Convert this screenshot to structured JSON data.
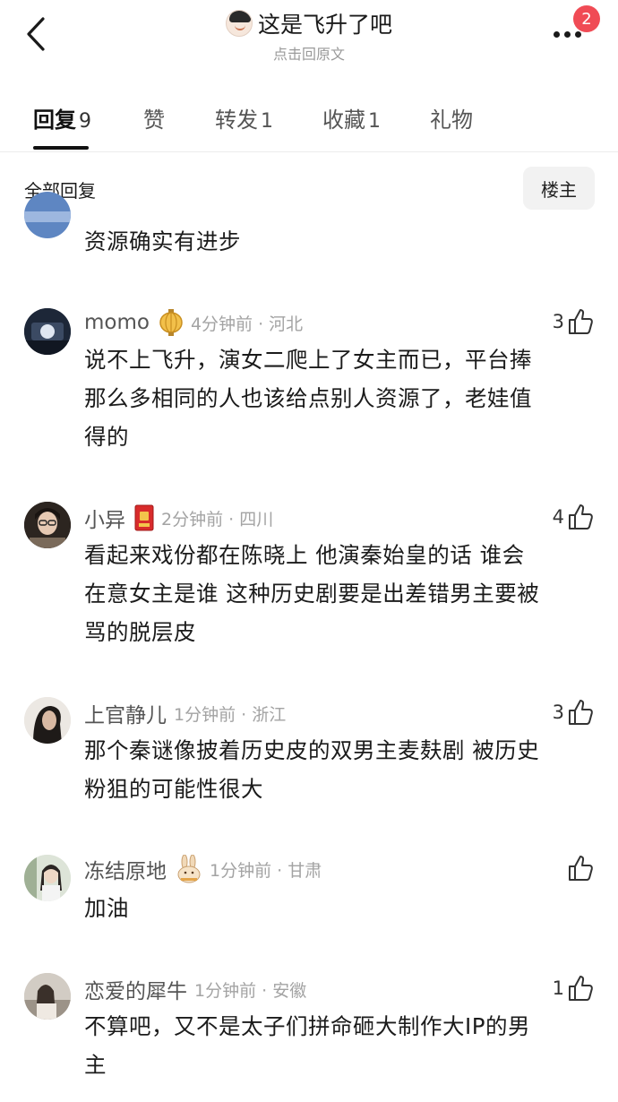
{
  "header": {
    "back_icon": "chevron-left-icon",
    "title": "这是飞升了吧",
    "subtitle": "点击回原文",
    "more_icon": "more-dots-icon",
    "notification_badge": "2",
    "badge_color": "#f04b55"
  },
  "tabs": [
    {
      "label": "回复",
      "count": "9",
      "active": true
    },
    {
      "label": "赞",
      "count": "",
      "active": false
    },
    {
      "label": "转发",
      "count": "1",
      "active": false
    },
    {
      "label": "收藏",
      "count": "1",
      "active": false
    },
    {
      "label": "礼物",
      "count": "",
      "active": false
    }
  ],
  "filter": {
    "all_replies": "全部回复",
    "op_only": "楼主"
  },
  "partial_comment": {
    "text": "资源确实有进步"
  },
  "comments": [
    {
      "name": "momo",
      "badge": "lantern-badge-icon",
      "meta": "4分钟前 · 河北",
      "likes": "3",
      "text": [
        "说不上飞升，演女二爬上了女主而已，平台捧",
        "那么多相同的人也该给点别人资源了，老娃值",
        "得的"
      ]
    },
    {
      "name": "小异",
      "badge": "red-envelope-badge-icon",
      "meta": "2分钟前 · 四川",
      "likes": "4",
      "text": [
        "看起来戏份都在陈晓上 他演秦始皇的话 谁会",
        "在意女主是谁 这种历史剧要是出差错男主要被",
        "骂的脱层皮"
      ]
    },
    {
      "name": "上官静儿",
      "badge": "",
      "meta": "1分钟前 · 浙江",
      "likes": "3",
      "text": [
        "那个秦谜像披着历史皮的双男主麦麸剧 被历史",
        "粉狙的可能性很大"
      ]
    },
    {
      "name": "冻结原地",
      "badge": "rabbit-badge-icon",
      "meta": "1分钟前 · 甘肃",
      "likes": "",
      "text": [
        "加油"
      ]
    },
    {
      "name": "恋爱的犀牛",
      "badge": "",
      "meta": "1分钟前 · 安徽",
      "likes": "1",
      "text": [
        "不算吧，又不是太子们拼命砸大制作大IP的男",
        "主"
      ]
    }
  ]
}
